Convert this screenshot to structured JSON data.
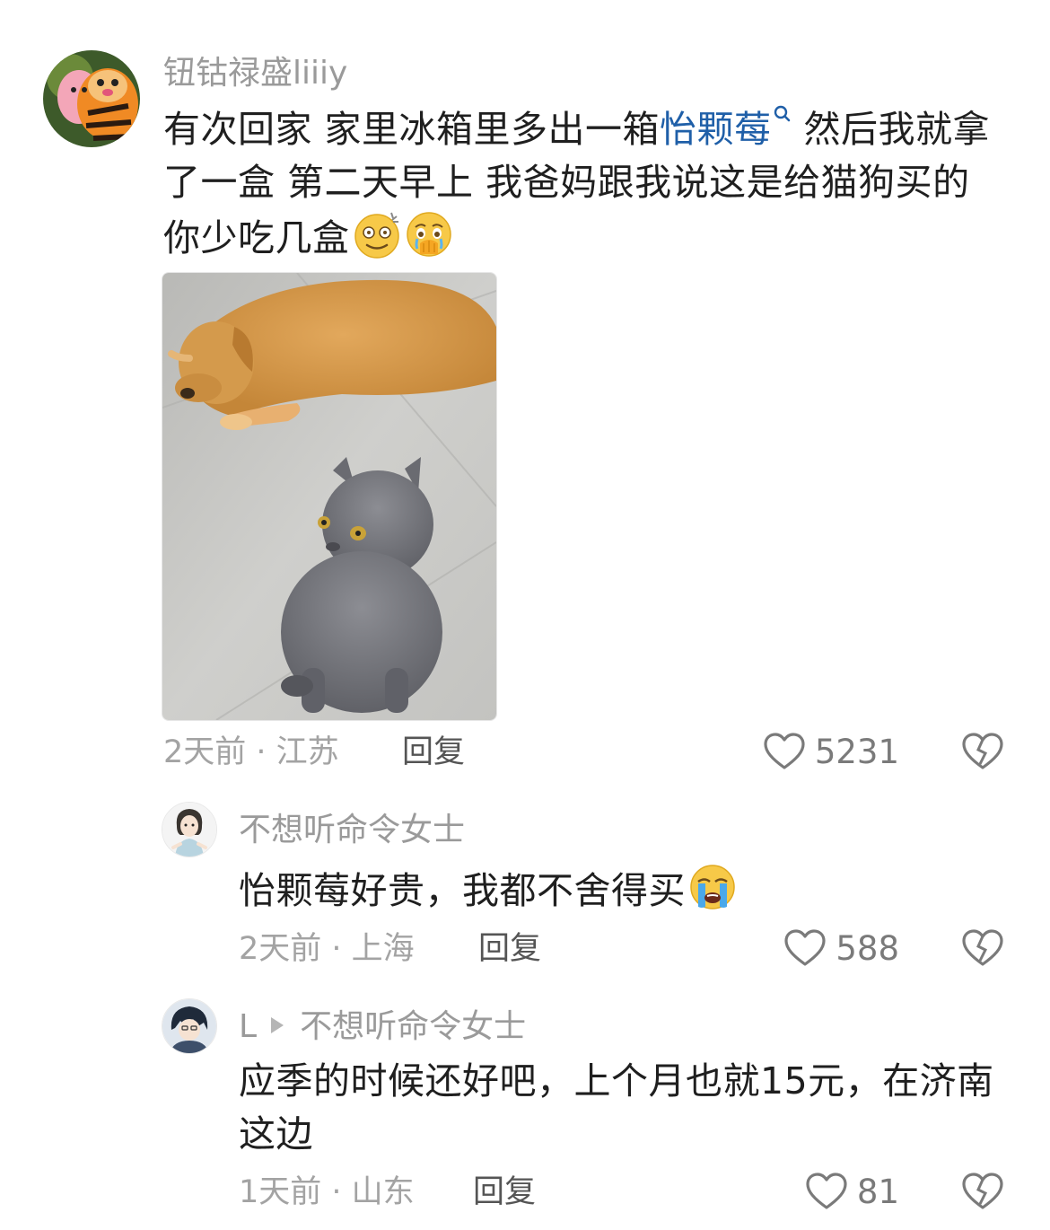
{
  "comments": [
    {
      "username": "钮钴禄盛liiiy",
      "text_part1": "有次回家 家里冰箱里多出一箱",
      "link_text": "怡颗莓",
      "text_part2": "然后我就拿了一盒 第二天早上 我爸妈跟我说这是给猫狗买的 你少吃几盒",
      "emojis": [
        "dizzy-smile-emoji",
        "holding-back-tears-emoji"
      ],
      "image": "golden-retriever-and-gray-cat-photo",
      "time_location": "2天前 · 江苏",
      "reply_label": "回复",
      "likes": "5231"
    },
    {
      "username": "不想听命令女士",
      "text": "怡颗莓好贵，我都不舍得买",
      "emojis": [
        "loudly-crying-emoji"
      ],
      "time_location": "2天前 · 上海",
      "reply_label": "回复",
      "likes": "588"
    },
    {
      "username": "L",
      "reply_to": "不想听命令女士",
      "text": "应季的时候还好吧，上个月也就15元，在济南这边",
      "time_location": "1天前 · 山东",
      "reply_label": "回复",
      "likes": "81"
    }
  ],
  "colors": {
    "link": "#1f5fa8",
    "meta": "#a3a3a3",
    "username": "#9a9a9a",
    "text": "#1f1f1f"
  }
}
